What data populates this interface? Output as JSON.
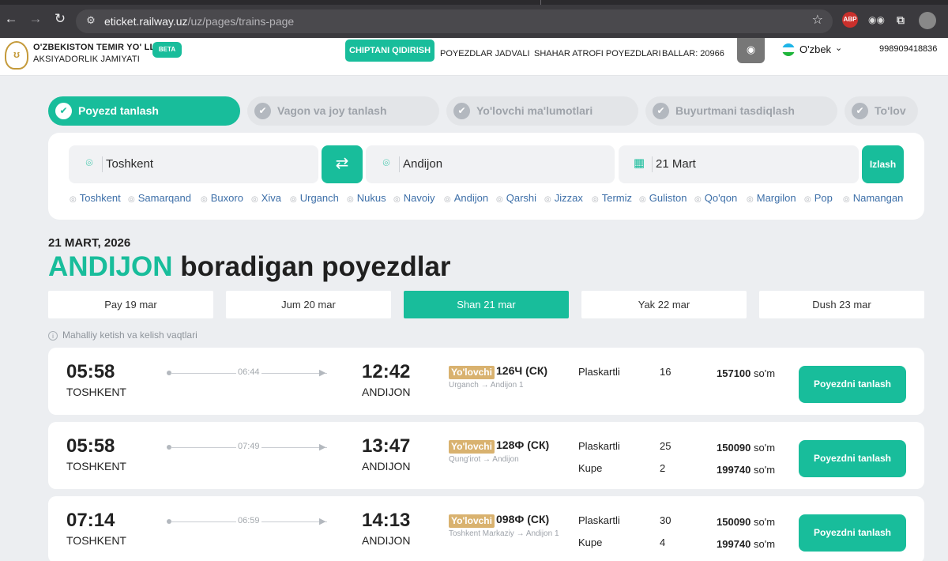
{
  "browser": {
    "back_icon": "arrow-left-icon",
    "forward_icon": "arrow-right-icon",
    "reload_icon": "reload-icon",
    "url_host": "eticket.railway.uz",
    "url_path": "/uz/pages/trains-page",
    "ext_abp": "ABP"
  },
  "header": {
    "brand_line1": "O'ZBEKISTON TEMIR YO' LLARI",
    "brand_line2": "AKSIYADORLIK JAMIYATI",
    "beta": "BETA",
    "menu": [
      "CHIPTANI QIDIRISH",
      "POYEZDLAR JADVALI",
      "SHAHAR ATROFI POYEZDLARI",
      "BALLAR: 20966"
    ],
    "language": "O'zbek",
    "phone": "998909418836",
    "flag_colors": [
      "#1eb5e8",
      "#ffffff",
      "#1eb53a"
    ]
  },
  "steps": [
    "Poyezd tanlash",
    "Vagon va joy tanlash",
    "Yo'lovchi ma'lumotlari",
    "Buyurtmani tasdiqlash",
    "To'lov"
  ],
  "search": {
    "from": "Toshkent",
    "to": "Andijon",
    "date": "21 Mart",
    "button": "Izlash",
    "cities": [
      "Toshkent",
      "Samarqand",
      "Buxoro",
      "Xiva",
      "Urganch",
      "Nukus",
      "Navoiy",
      "Andijon",
      "Qarshi",
      "Jizzax",
      "Termiz",
      "Guliston",
      "Qo'qon",
      "Margilon",
      "Pop",
      "Namangan"
    ]
  },
  "results": {
    "date_label": "21 MART, 2026",
    "headline_highlight": "ANDIJON",
    "headline_rest": " boradigan poyezdlar",
    "days": [
      "Pay 19 mar",
      "Jum 20 mar",
      "Shan 21 mar",
      "Yak 22 mar",
      "Dush 23 mar"
    ],
    "active_day": "Shan 21 mar",
    "note": "Mahalliy ketish va kelish vaqtlari"
  },
  "trains": [
    {
      "dep_time": "05:58",
      "dep_city": "TOSHKENT",
      "duration": "06:44",
      "arr_time": "12:42",
      "arr_city": "ANDIJON",
      "badge": "Yo'lovchi",
      "number": "126Ч (СК)",
      "route": "Urganch → Andijon 1",
      "classes": [
        {
          "name": "Plaskartli",
          "seats": "16",
          "price": "157100",
          "currency": "so'm"
        }
      ],
      "button": "Poyezdni tanlash"
    },
    {
      "dep_time": "05:58",
      "dep_city": "TOSHKENT",
      "duration": "07:49",
      "arr_time": "13:47",
      "arr_city": "ANDIJON",
      "badge": "Yo'lovchi",
      "number": "128Ф (СК)",
      "route": "Qung'irot → Andijon",
      "classes": [
        {
          "name": "Plaskartli",
          "seats": "25",
          "price": "150090",
          "currency": "so'm"
        },
        {
          "name": "Kupe",
          "seats": "2",
          "price": "199740",
          "currency": "so'm"
        }
      ],
      "button": "Poyezdni tanlash"
    },
    {
      "dep_time": "07:14",
      "dep_city": "TOSHKENT",
      "duration": "06:59",
      "arr_time": "14:13",
      "arr_city": "ANDIJON",
      "badge": "Yo'lovchi",
      "number": "098Ф (СК)",
      "route": "Toshkent Markaziy → Andijon 1",
      "classes": [
        {
          "name": "Plaskartli",
          "seats": "30",
          "price": "150090",
          "currency": "so'm"
        },
        {
          "name": "Kupe",
          "seats": "4",
          "price": "199740",
          "currency": "so'm"
        }
      ],
      "button": "Poyezdni tanlash"
    }
  ],
  "colors": {
    "accent": "#18bd9b",
    "badge": "#d9b26f",
    "link": "#3d6fa8"
  }
}
